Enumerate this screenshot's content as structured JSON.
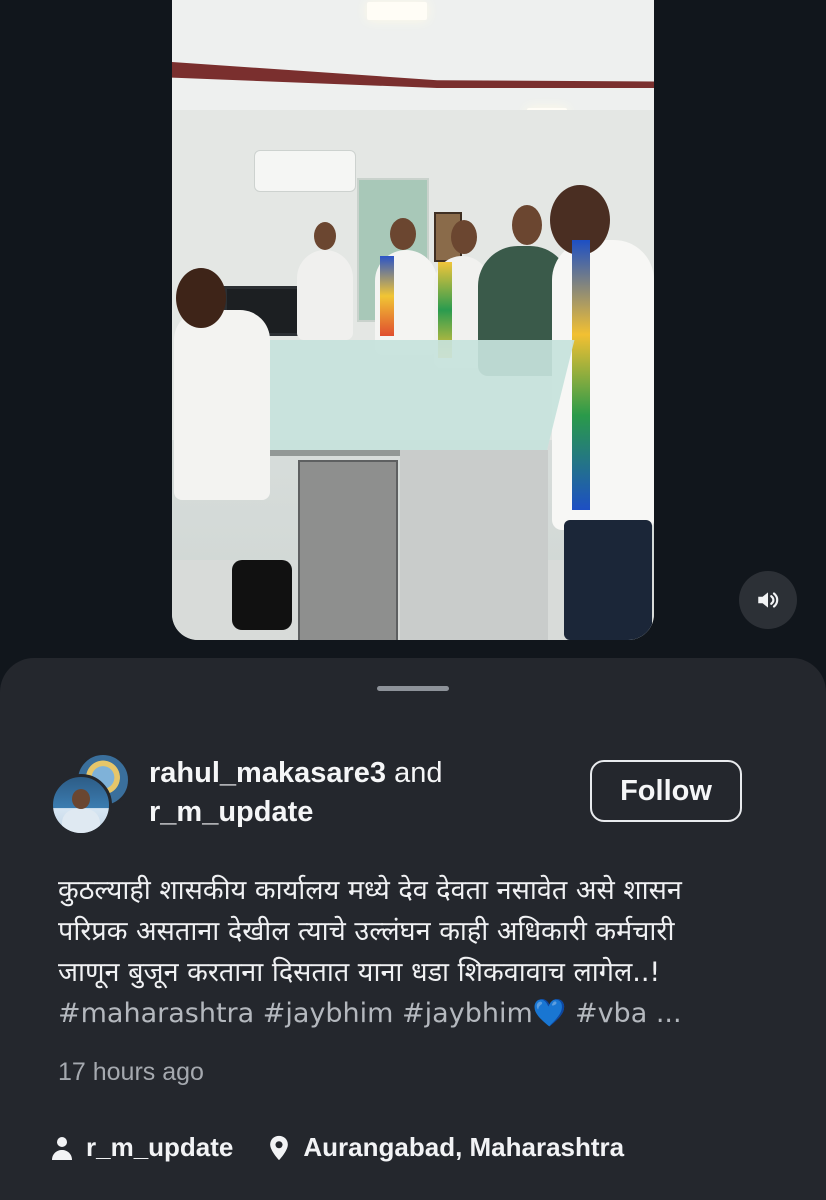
{
  "post": {
    "author_primary": "rahul_makasare3",
    "author_conjunction": "and",
    "author_secondary": "r_m_update",
    "follow_label": "Follow",
    "caption_lines": [
      "कुठल्याही शासकीय कार्यालय मध्ये देव देवता नसावेत असे शासन",
      "परिप्रक असताना देखील त्याचे उल्लंघन काही अधिकारी कर्मचारी",
      "जाणून बुजून करताना दिसतात याना धडा शिकवावाच लागेल..!"
    ],
    "hashtags": "#maharashtra #jaybhim #jaybhim💙 #vba ...",
    "timestamp": "17 hours ago",
    "audio_account": "r_m_update",
    "location": "Aurangabad, Maharashtra"
  },
  "icons": {
    "volume": "volume-icon",
    "person": "person-icon",
    "location": "location-pin-icon"
  },
  "colors": {
    "background": "#11161c",
    "sheet": "#24272d",
    "text": "#f2f3f5",
    "muted": "#a5a9af"
  }
}
